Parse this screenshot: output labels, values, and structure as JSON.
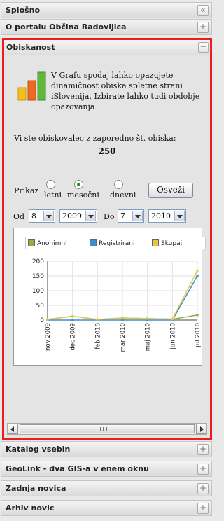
{
  "sections": {
    "splosno": "Splošno",
    "portal": "O portalu Občina Radovljica",
    "obiskanost": "Obiskanost",
    "katalog": "Katalog vsebin",
    "geolink": "GeoLink - dva GIS-a v enem oknu",
    "zadnja": "Zadnja novica",
    "arhiv": "Arhiv novic"
  },
  "buttons": {
    "collapse_all": "«",
    "expand": "+",
    "collapse": "−"
  },
  "icons": [
    "collapse-all-icon",
    "expand-icon",
    "collapse-icon",
    "bar-chart-logo"
  ],
  "obiskanost": {
    "description": "V Grafu spodaj lahko opazujete dinamičnost obiska spletne strani iSlovenija. Izbirate lahko tudi obdobje opazovanja",
    "visitor_text": "Vi ste obiskovalec z zaporedno št. obiska:",
    "visitor_number": "250",
    "prikaz_label": "Prikaz",
    "options": [
      "letni",
      "mesečni",
      "dnevni"
    ],
    "selected_option": "mesečni",
    "refresh_label": "Osveži",
    "od_label": "Od",
    "do_label": "Do",
    "od_month": "8",
    "od_year": "2009",
    "do_month": "7",
    "do_year": "2010"
  },
  "colors": {
    "highlight_border": "#ee1c1c",
    "anonimni": "#8fb040",
    "registrirani": "#3a8fd0",
    "skupaj": "#e8c840"
  },
  "chart_data": {
    "type": "line",
    "legend_position": "top",
    "categories": [
      "nov 2009",
      "dec 2009",
      "feb 2010",
      "mar 2010",
      "maj 2010",
      "jun 2010",
      "jul 2010"
    ],
    "series": [
      {
        "name": "Anonimni",
        "values": [
          2,
          13,
          2,
          7,
          5,
          3,
          17
        ]
      },
      {
        "name": "Registrirani",
        "values": [
          0,
          0,
          0,
          0,
          0,
          0,
          150
        ]
      },
      {
        "name": "Skupaj",
        "values": [
          2,
          13,
          2,
          7,
          5,
          3,
          168
        ]
      }
    ],
    "ylim": [
      0,
      200
    ],
    "yticks": [
      0,
      50,
      100,
      150,
      200
    ],
    "grid": true
  }
}
